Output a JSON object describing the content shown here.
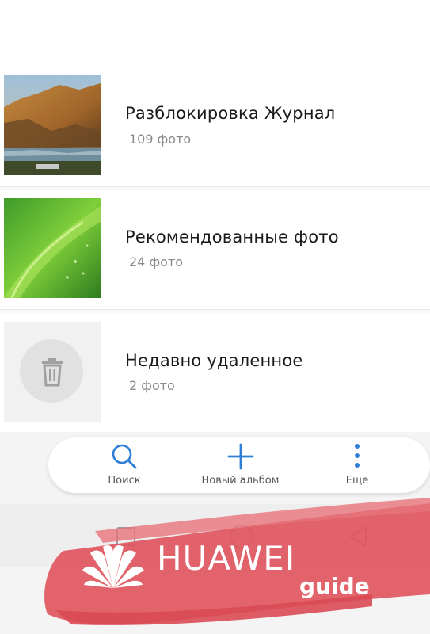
{
  "albums": [
    {
      "title": "Разблокировка Журнал",
      "count": "109 фото",
      "thumb": "landscape-thumbnail"
    },
    {
      "title": "Рекомендованные фото",
      "count": "24 фото",
      "thumb": "green-leaf-thumbnail"
    },
    {
      "title": "Недавно удаленное",
      "count": "2 фото",
      "thumb": "trash-icon"
    }
  ],
  "toolbar": {
    "search_label": "Поиск",
    "new_album_label": "Новый альбом",
    "more_label": "Еще",
    "accent": "#2f7fd6"
  },
  "navigation": {
    "icons": [
      "recents-square-icon",
      "home-circle-icon",
      "back-triangle-icon"
    ]
  },
  "watermark": {
    "brand": "HUAWEI",
    "sub": "guide",
    "color": "#e0565f"
  }
}
